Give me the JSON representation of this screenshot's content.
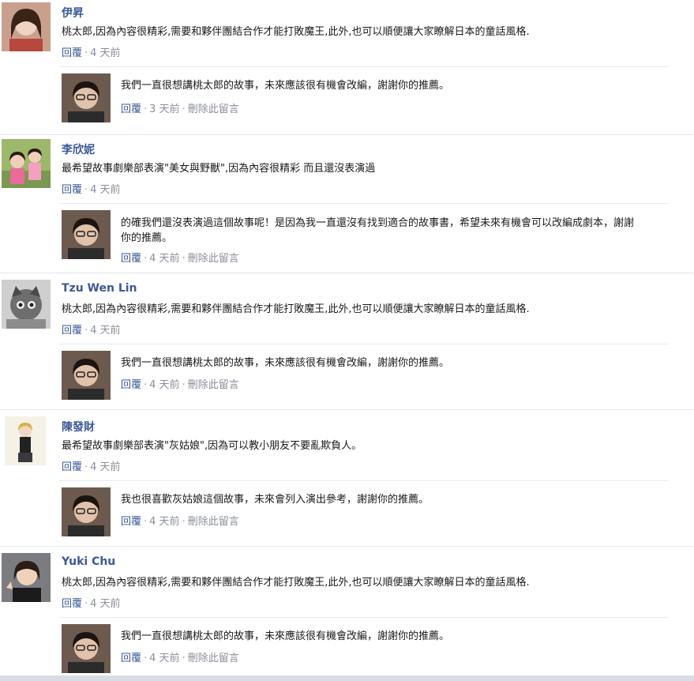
{
  "threads": [
    {
      "author": "伊昇",
      "text": "桃太郎,因為內容很精彩,需要和夥伴團結合作才能打敗魔王,此外,也可以順便讓大家瞭解日本的童話風格.",
      "reply_label": "回覆",
      "time": "4 天前",
      "reply": {
        "text": "我們一直很想講桃太郎的故事，未來應該很有機會改編，謝謝你的推薦。",
        "reply_label": "回覆",
        "time": "3 天前",
        "delete_label": "刪除此留言"
      }
    },
    {
      "author": "李欣妮",
      "text": "最希望故事劇樂部表演\"美女與野獸\",因為內容很精彩 而且還沒表演過",
      "reply_label": "回覆",
      "time": "4 天前",
      "reply": {
        "text": "的確我們還沒表演過這個故事呢！是因為我一直還沒有找到適合的故事書，希望未來有機會可以改編成劇本，謝謝你的推薦。",
        "reply_label": "回覆",
        "time": "4 天前",
        "delete_label": "刪除此留言"
      }
    },
    {
      "author": "Tzu Wen Lin",
      "text": "桃太郎,因為內容很精彩,需要和夥伴團結合作才能打敗魔王,此外,也可以順便讓大家瞭解日本的童話風格.",
      "reply_label": "回覆",
      "time": "4 天前",
      "reply": {
        "text": "我們一直很想講桃太郎的故事，未來應該很有機會改編，謝謝你的推薦。",
        "reply_label": "回覆",
        "time": "4 天前",
        "delete_label": "刪除此留言"
      }
    },
    {
      "author": "陳發財",
      "text": "最希望故事劇樂部表演\"灰姑娘\",因為可以教小朋友不要亂欺負人。",
      "reply_label": "回覆",
      "time": "4 天前",
      "reply": {
        "text": "我也很喜歡灰姑娘這個故事，未來會列入演出參考，謝謝你的推薦。",
        "reply_label": "回覆",
        "time": "4 天前",
        "delete_label": "刪除此留言"
      }
    },
    {
      "author": "Yuki Chu",
      "text": "桃太郎,因為內容很精彩,需要和夥伴團結合作才能打敗魔王,此外,也可以順便讓大家瞭解日本的童話風格.",
      "reply_label": "回覆",
      "time": "4 天前",
      "reply": {
        "text": "我們一直很想講桃太郎的故事，未來應該很有機會改編，謝謝你的推薦。",
        "reply_label": "回覆",
        "time": "4 天前",
        "delete_label": "刪除此留言"
      }
    }
  ],
  "colors": {
    "link": "#3b5998",
    "meta": "#8a8f99",
    "separator": "#e3e6ec"
  }
}
